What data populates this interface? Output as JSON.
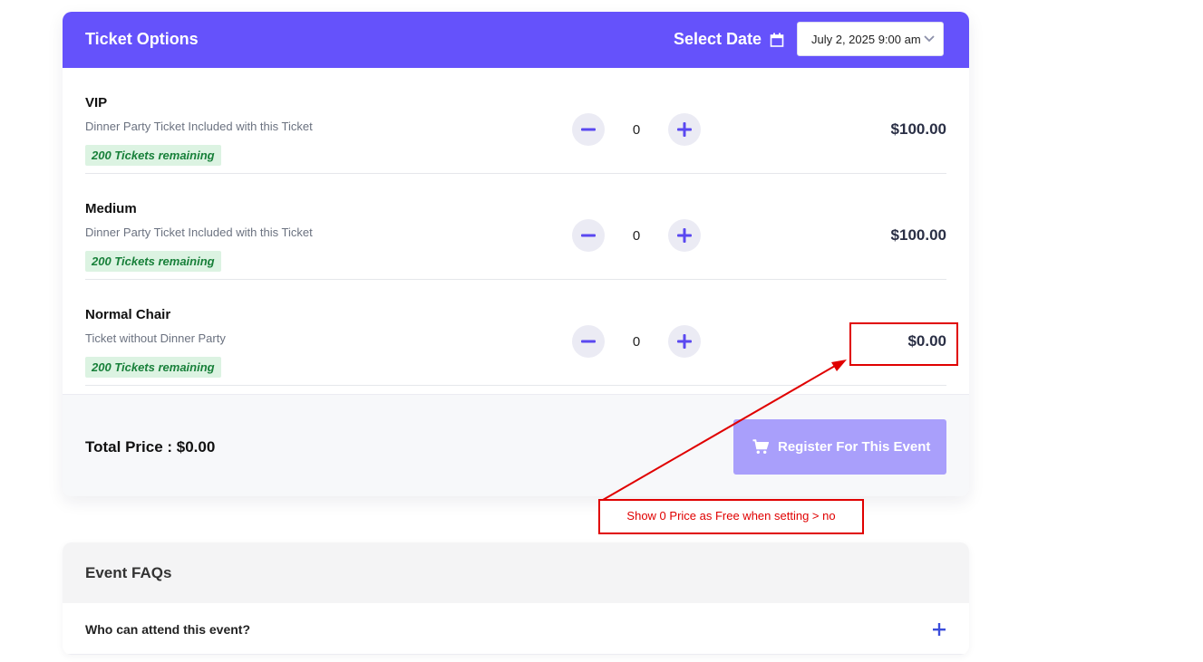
{
  "header": {
    "title": "Ticket Options",
    "select_date_label": "Select Date",
    "date_value": "July 2, 2025 9:00 am"
  },
  "tickets": [
    {
      "name": "VIP",
      "description": "Dinner Party Ticket Included with this Ticket",
      "remaining": "200 Tickets remaining",
      "quantity": "0",
      "price": "$100.00"
    },
    {
      "name": "Medium",
      "description": "Dinner Party Ticket Included with this Ticket",
      "remaining": "200 Tickets remaining",
      "quantity": "0",
      "price": "$100.00"
    },
    {
      "name": "Normal Chair",
      "description": "Ticket without Dinner Party",
      "remaining": "200 Tickets remaining",
      "quantity": "0",
      "price": "$0.00"
    }
  ],
  "footer": {
    "total_label": "Total Price : $0.00",
    "register_label": "Register For This Event"
  },
  "annotation": {
    "note": "Show 0 Price as Free when setting > no"
  },
  "faq": {
    "title": "Event FAQs",
    "questions": [
      "Who can attend this event?"
    ]
  },
  "colors": {
    "accent": "#6552fb",
    "register_button": "#a99ffb",
    "badge_bg": "#dcf3e2",
    "badge_text": "#18803a",
    "annotation_red": "#e00000"
  },
  "icons": {
    "calendar": "calendar-icon",
    "chevron": "chevron-down-icon",
    "minus": "minus-icon",
    "plus": "plus-icon",
    "cart": "cart-icon"
  }
}
